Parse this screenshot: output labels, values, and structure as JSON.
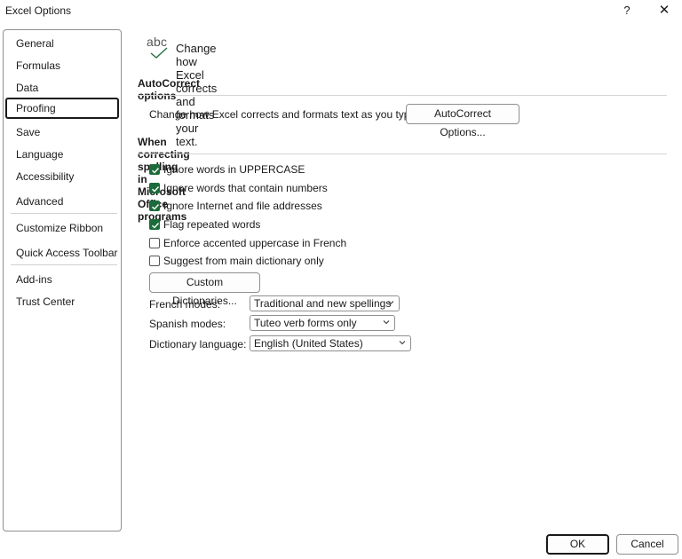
{
  "window": {
    "title": "Excel Options",
    "help_label": "?",
    "close_label": "✕"
  },
  "sidebar": {
    "items": [
      {
        "label": "General"
      },
      {
        "label": "Formulas"
      },
      {
        "label": "Data"
      },
      {
        "label": "Proofing",
        "selected": true
      },
      {
        "label": "Save"
      },
      {
        "label": "Language"
      },
      {
        "label": "Accessibility"
      },
      {
        "label": "Advanced"
      },
      {
        "label": "Customize Ribbon"
      },
      {
        "label": "Quick Access Toolbar"
      },
      {
        "label": "Add-ins"
      },
      {
        "label": "Trust Center"
      }
    ]
  },
  "header": {
    "icon_text": "abc",
    "text": "Change how Excel corrects and formats your text."
  },
  "autocorrect": {
    "section_title": "AutoCorrect options",
    "description": "Change how Excel corrects and formats text as you type:",
    "button_label": "AutoCorrect Options..."
  },
  "spelling": {
    "section_title": "When correcting spelling in Microsoft Office programs",
    "checkboxes": [
      {
        "label": "Ignore words in UPPERCASE",
        "checked": true
      },
      {
        "label": "Ignore words that contain numbers",
        "checked": true
      },
      {
        "label": "Ignore Internet and file addresses",
        "checked": true
      },
      {
        "label": "Flag repeated words",
        "checked": true
      },
      {
        "label": "Enforce accented uppercase in French",
        "checked": false
      },
      {
        "label": "Suggest from main dictionary only",
        "checked": false
      }
    ],
    "custom_dictionaries_label": "Custom Dictionaries...",
    "french_modes": {
      "label": "French modes:",
      "value": "Traditional and new spellings"
    },
    "spanish_modes": {
      "label": "Spanish modes:",
      "value": "Tuteo verb forms only"
    },
    "dictionary_language": {
      "label": "Dictionary language:",
      "value": "English (United States)"
    }
  },
  "footer": {
    "ok_label": "OK",
    "cancel_label": "Cancel"
  },
  "colors": {
    "checkbox_checked": "#1c6b3a",
    "border": "#8f8f8f"
  }
}
